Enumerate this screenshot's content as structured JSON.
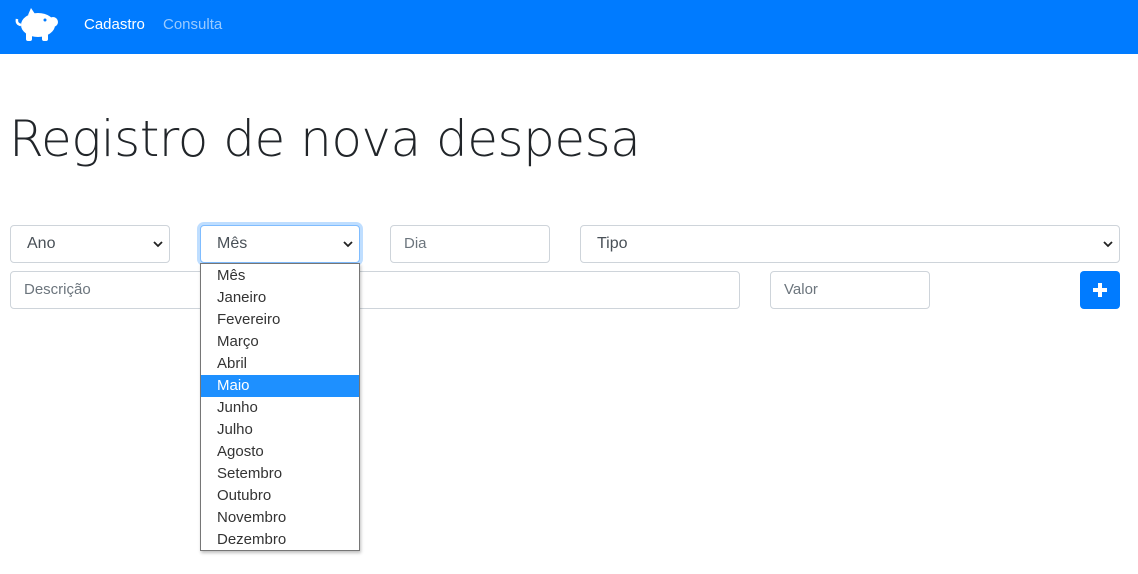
{
  "navbar": {
    "brand_color": "#007bff",
    "logo_icon": "piggy-bank-icon",
    "links": [
      {
        "label": "Cadastro",
        "active": true
      },
      {
        "label": "Consulta",
        "active": false
      }
    ]
  },
  "page_title": "Registro de nova despesa",
  "form": {
    "ano": {
      "selected": "Ano"
    },
    "mes": {
      "selected": "Mês"
    },
    "dia": {
      "placeholder": "Dia"
    },
    "tipo": {
      "selected": "Tipo"
    },
    "descricao": {
      "placeholder": "Descrição"
    },
    "valor": {
      "placeholder": "Valor"
    },
    "add_button_icon": "plus-icon"
  },
  "mes_dropdown": {
    "highlighted": "Maio",
    "options": [
      "Mês",
      "Janeiro",
      "Fevereiro",
      "Março",
      "Abril",
      "Maio",
      "Junho",
      "Julho",
      "Agosto",
      "Setembro",
      "Outubro",
      "Novembro",
      "Dezembro"
    ]
  }
}
